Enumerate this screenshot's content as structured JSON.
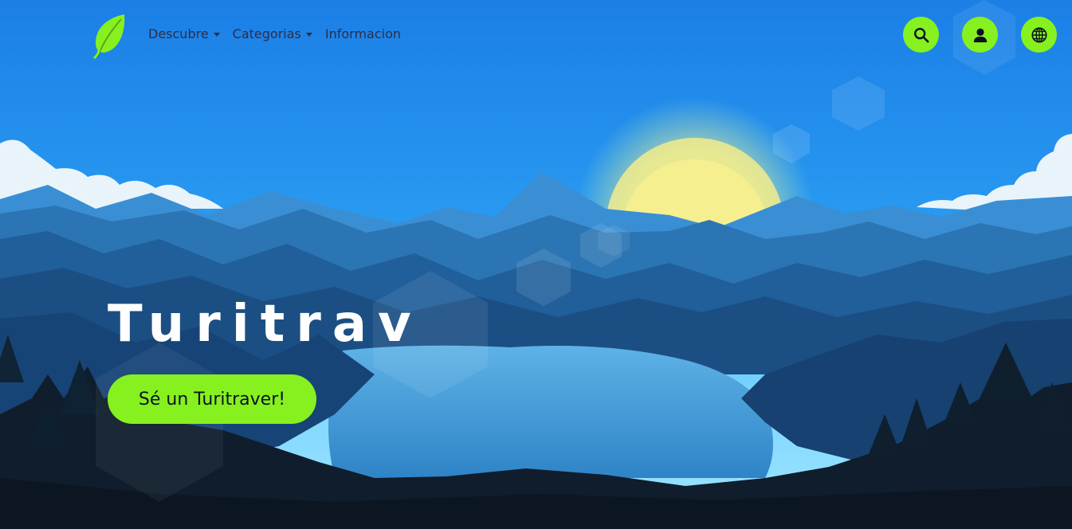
{
  "nav": {
    "logo": "leaf-icon",
    "links": [
      {
        "label": "Descubre",
        "dropdown": true
      },
      {
        "label": "Categorias",
        "dropdown": true
      },
      {
        "label": "Informacion",
        "dropdown": false
      }
    ],
    "actions": [
      "search-icon",
      "user-icon",
      "globe-icon"
    ]
  },
  "hero": {
    "title": "Turitrav",
    "cta_label": "Sé un Turitraver!"
  },
  "colors": {
    "accent": "#86f11e",
    "nav_text": "#2a2f4b",
    "sky_top": "#1a82e8",
    "sky_bottom": "#7fd7ff",
    "sun": "#f3ec8a"
  }
}
